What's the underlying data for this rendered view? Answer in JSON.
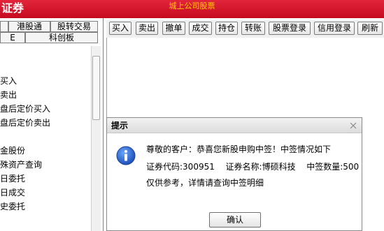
{
  "app": {
    "logo_text": "证券",
    "window_title": "城上公司股票"
  },
  "left_panel": {
    "tabs_row1": [
      "港股通",
      "股转交易"
    ],
    "tabs_row2": [
      "E",
      "科创板"
    ],
    "menu_items": [
      "买入",
      "卖出",
      "盘后定价买入",
      "盘后定价卖出",
      "",
      "金股份",
      "殊资产查询",
      "日委托",
      "日成交",
      "史委托"
    ]
  },
  "toolbar": {
    "buttons": [
      "买入",
      "卖出",
      "撤单",
      "成交",
      "持仓",
      "转账",
      "股票登录",
      "信用登录",
      "刷新"
    ]
  },
  "dialog": {
    "title": "提示",
    "greeting": "尊敬的客户：恭喜您新股申购中签！中签情况如下",
    "code_label": "证券代码:",
    "code_value": "300951",
    "name_label": "证券名称:",
    "name_value": "博硕科技",
    "qty_label": "中签数量:",
    "qty_value": "500",
    "note": "仅供参考，详情请查询中签明细",
    "ok_label": "确认"
  }
}
